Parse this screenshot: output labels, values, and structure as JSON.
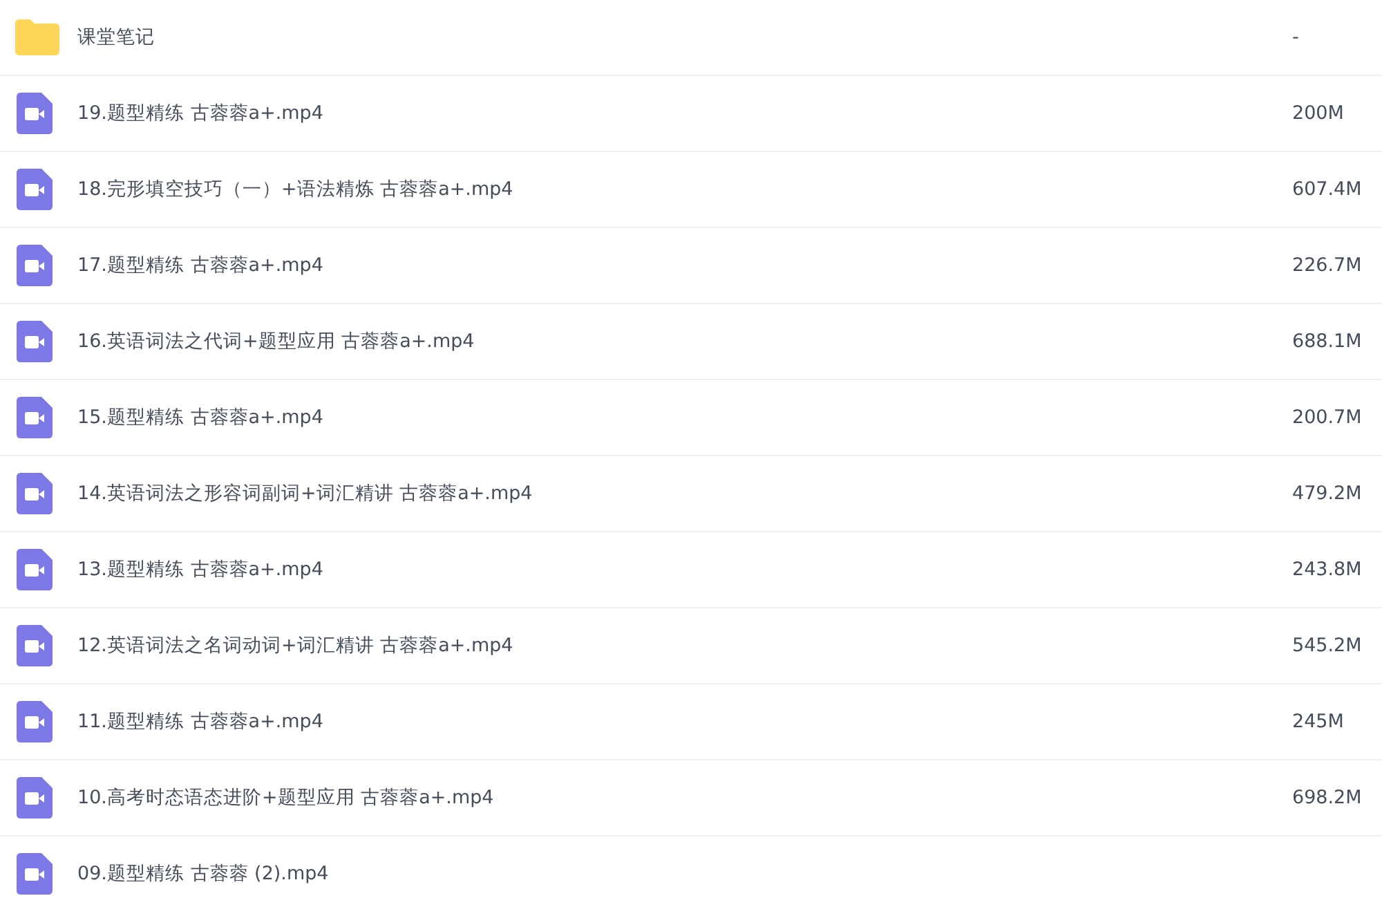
{
  "files": [
    {
      "kind": "folder",
      "name": "课堂笔记",
      "size": "-"
    },
    {
      "kind": "video",
      "name": "19.题型精练 古蓉蓉a+.mp4",
      "size": "200M"
    },
    {
      "kind": "video",
      "name": "18.完形填空技巧（一）+语法精炼 古蓉蓉a+.mp4",
      "size": "607.4M"
    },
    {
      "kind": "video",
      "name": "17.题型精练 古蓉蓉a+.mp4",
      "size": "226.7M"
    },
    {
      "kind": "video",
      "name": "16.英语词法之代词+题型应用 古蓉蓉a+.mp4",
      "size": "688.1M"
    },
    {
      "kind": "video",
      "name": "15.题型精练 古蓉蓉a+.mp4",
      "size": "200.7M"
    },
    {
      "kind": "video",
      "name": "14.英语词法之形容词副词+词汇精讲 古蓉蓉a+.mp4",
      "size": "479.2M"
    },
    {
      "kind": "video",
      "name": "13.题型精练 古蓉蓉a+.mp4",
      "size": "243.8M"
    },
    {
      "kind": "video",
      "name": "12.英语词法之名词动词+词汇精讲 古蓉蓉a+.mp4",
      "size": "545.2M"
    },
    {
      "kind": "video",
      "name": "11.题型精练 古蓉蓉a+.mp4",
      "size": "245M"
    },
    {
      "kind": "video",
      "name": "10.高考时态语态进阶+题型应用 古蓉蓉a+.mp4",
      "size": "698.2M"
    },
    {
      "kind": "video",
      "name": "09.题型精练 古蓉蓉 (2).mp4"
    }
  ]
}
